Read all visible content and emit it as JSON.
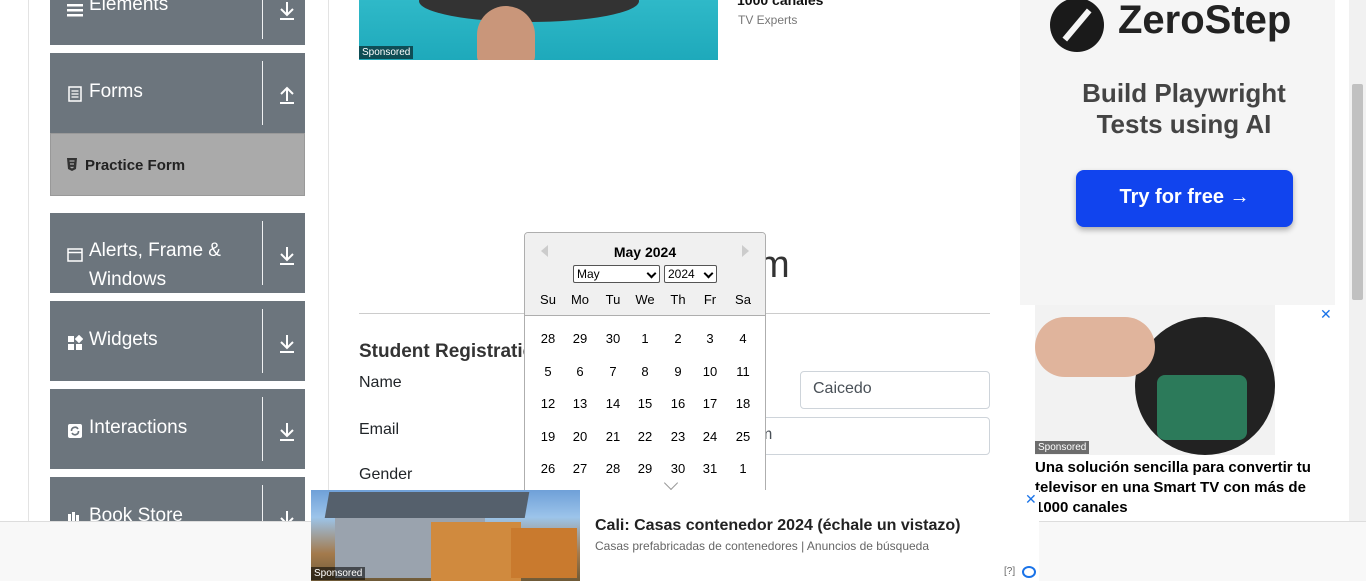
{
  "sidebar": {
    "groups": [
      {
        "label": "Elements"
      },
      {
        "label": "Forms"
      },
      {
        "label": "Alerts, Frame &"
      },
      {
        "label": "Widgets"
      },
      {
        "label": "Interactions"
      },
      {
        "label": "Book Store"
      }
    ],
    "alerts_label_line2": "Windows",
    "practice_form_label": "Practice Form"
  },
  "top_ad": {
    "sponsored": "Sponsored",
    "title": "1000 canales",
    "source": "TV Experts"
  },
  "form": {
    "title_fragment": "m",
    "section_heading": "Student Registratio",
    "name_label": "Name",
    "last_name_value": "Caicedo",
    "email_label": "Email",
    "email_value_fragment": "m",
    "gender_label": "Gender"
  },
  "datepicker": {
    "header": "May 2024",
    "month_select": "May",
    "year_select": "2024",
    "day_names": [
      "Su",
      "Mo",
      "Tu",
      "We",
      "Th",
      "Fr",
      "Sa"
    ],
    "weeks": [
      [
        "28",
        "29",
        "30",
        "1",
        "2",
        "3",
        "4"
      ],
      [
        "5",
        "6",
        "7",
        "8",
        "9",
        "10",
        "11"
      ],
      [
        "12",
        "13",
        "14",
        "15",
        "16",
        "17",
        "18"
      ],
      [
        "19",
        "20",
        "21",
        "22",
        "23",
        "24",
        "25"
      ],
      [
        "26",
        "27",
        "28",
        "29",
        "30",
        "31",
        "1"
      ]
    ]
  },
  "right_ad": {
    "brand": "ZeroStep",
    "tagline": "Build Playwright Tests using AI",
    "cta": "Try for free →",
    "sponsored": "Sponsored",
    "text": "Una solución sencilla para convertir tu televisor en una Smart TV con más de 1000 canales",
    "close": "✕"
  },
  "bottom_ad": {
    "sponsored": "Sponsored",
    "title": "Cali: Casas contenedor 2024 (échale un vistazo)",
    "subtitle": "Casas prefabricadas de contenedores | Anuncios de búsqueda",
    "close": "✕",
    "info": "[?]"
  }
}
